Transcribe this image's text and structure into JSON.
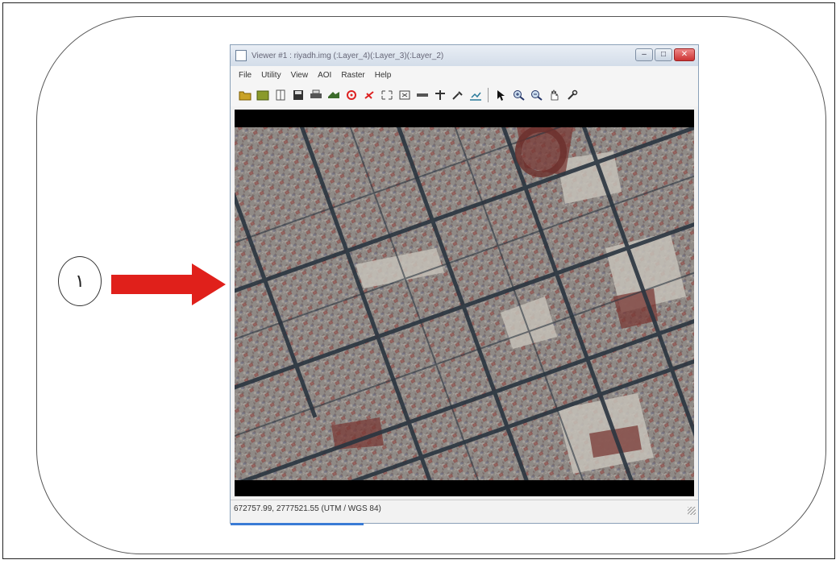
{
  "window": {
    "title": "Viewer #1 : riyadh.img (:Layer_4)(:Layer_3)(:Layer_2)"
  },
  "step_label": "١",
  "menu": [
    "File",
    "Utility",
    "View",
    "AOI",
    "Raster",
    "Help"
  ],
  "toolbar_icons": [
    "open-icon",
    "open-raster-icon",
    "page-icon",
    "save-icon",
    "print-icon",
    "layer-icon",
    "target-red-icon",
    "measure-red-icon",
    "fit-icon",
    "reset-icon",
    "ruler-icon",
    "crosshair-icon",
    "tools-icon",
    "chart-icon",
    "pointer-icon",
    "zoom-in-icon",
    "zoom-out-icon",
    "pan-hand-icon",
    "inquire-icon"
  ],
  "status": {
    "coordinates": "672757.99, 2777521.55  (UTM / WGS 84)"
  },
  "colors": {
    "arrow": "#e0201b",
    "window_border": "#8aa0b8",
    "close_button": "#c33333"
  }
}
